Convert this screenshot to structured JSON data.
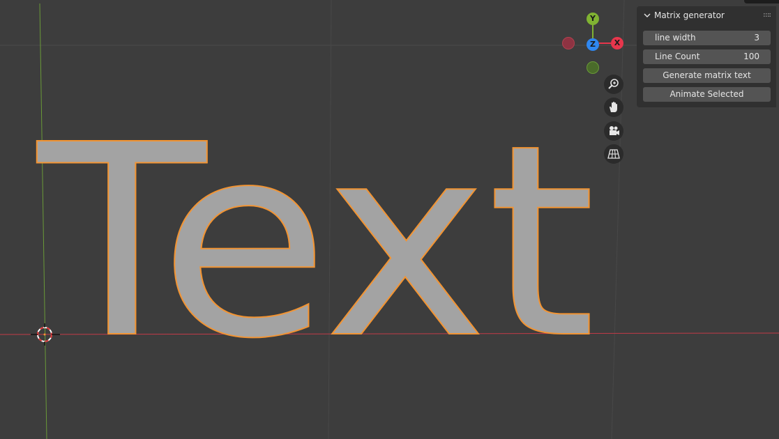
{
  "viewport": {
    "text_object": "Text",
    "axis_colors": {
      "x": "#c33b48",
      "y": "#6a9a38"
    },
    "outline_color": "#f29433",
    "text_fill": "#a3a3a3"
  },
  "gizmo": {
    "y_label": "Y",
    "z_label": "Z",
    "x_label": "X"
  },
  "nav_buttons": [
    {
      "icon": "zoom-icon"
    },
    {
      "icon": "hand-pan-icon"
    },
    {
      "icon": "camera-icon"
    },
    {
      "icon": "perspective-grid-icon"
    }
  ],
  "panel": {
    "title": "Matrix generator",
    "line_width_label": "line width",
    "line_width_value": "3",
    "line_count_label": "Line Count",
    "line_count_value": "100",
    "generate_label": "Generate matrix text",
    "animate_label": "Animate Selected"
  }
}
